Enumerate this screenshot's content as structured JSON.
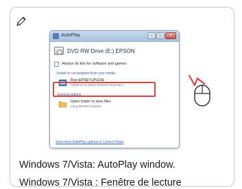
{
  "window": {
    "title": "AutoPlay",
    "drive_label": "DVD RW Drive (E:) EPSON",
    "checkbox_label": "Always do this for software and games:",
    "section_install": "Install or run program from your media",
    "run_item": {
      "title": "Run EPSETUP.EXE",
      "subtitle": "Published by SEIKO EPSON Corporation"
    },
    "section_general": "General options",
    "open_item": {
      "title": "Open folder to view files",
      "subtitle": "using Windows Explorer"
    },
    "footer_link": "View more AutoPlay options in Control Panel",
    "buttons": {
      "minimize": "–",
      "maximize": "□",
      "close": "✕"
    }
  },
  "captions": {
    "line1": "Windows 7/Vista: AutoPlay window.",
    "line2": "Windows 7/Vista : Fenêtre de lecture"
  },
  "colors": {
    "highlight": "#e24040",
    "click_mark": "#e24040"
  },
  "icons": {
    "note": "pencil-icon",
    "mouse": "mouse-click-icon"
  }
}
